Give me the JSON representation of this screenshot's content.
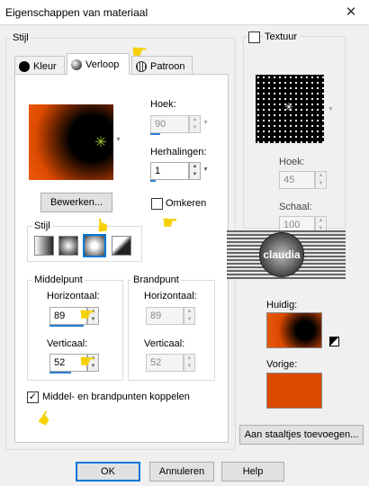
{
  "window": {
    "title": "Eigenschappen van materiaal",
    "close_glyph": "✕"
  },
  "stijl": {
    "group_label": "Stijl",
    "tabs": [
      {
        "label": "Kleur",
        "icon": "black-circle-icon"
      },
      {
        "label": "Verloop",
        "icon": "gradient-sphere-icon"
      },
      {
        "label": "Patroon",
        "icon": "pattern-globe-icon"
      }
    ],
    "active_tab": "Verloop"
  },
  "verloop": {
    "hoek_label": "Hoek:",
    "hoek_value": "90",
    "herhalingen_label": "Herhalingen:",
    "herhalingen_value": "1",
    "bewerken_label": "Bewerken...",
    "omkeren_label": "Omkeren",
    "omkeren_checked": false,
    "stijl_label": "Stijl",
    "style_options": [
      "linear",
      "radial",
      "rectangular",
      "sunburst"
    ],
    "selected_style": "rectangular",
    "middelpunt": {
      "label": "Middelpunt",
      "horizontaal_label": "Horizontaal:",
      "horizontaal_value": "89",
      "verticaal_label": "Verticaal:",
      "verticaal_value": "52"
    },
    "brandpunt": {
      "label": "Brandpunt",
      "horizontaal_label": "Horizontaal:",
      "horizontaal_value": "89",
      "verticaal_label": "Verticaal:",
      "verticaal_value": "52"
    },
    "koppelen_label": "Middel- en brandpunten koppelen",
    "koppelen_checked": true
  },
  "textuur": {
    "label": "Textuur",
    "checked": false,
    "hoek_label": "Hoek:",
    "hoek_value": "45",
    "schaal_label": "Schaal:",
    "schaal_value": "100"
  },
  "watermark": {
    "text": "claudia"
  },
  "preview": {
    "huidig_label": "Huidig:",
    "vorige_label": "Vorige:",
    "vorige_color": "#dc4a00"
  },
  "buttons": {
    "aan_staaltjes": "Aan staaltjes toevoegen...",
    "ok": "OK",
    "annuleren": "Annuleren",
    "help": "Help"
  },
  "colors": {
    "gradient_dark": "#000000",
    "gradient_light": "#dc4a00",
    "accent": "#0078d7"
  }
}
